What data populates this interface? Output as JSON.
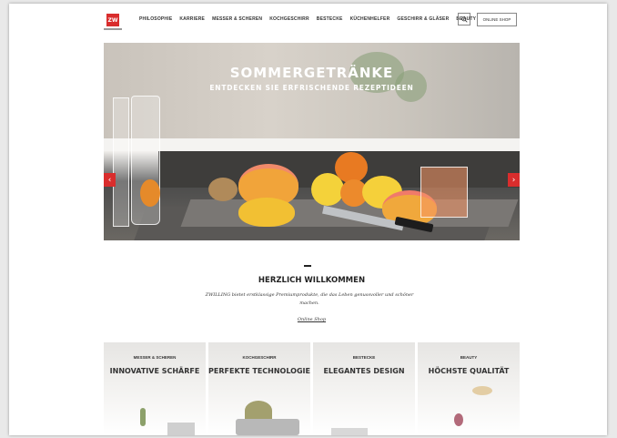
{
  "header": {
    "logo_text": "ZW",
    "nav": [
      "PHILOSOPHIE",
      "KARRIERE",
      "MESSER & SCHEREN",
      "KOCHGESCHIRR",
      "BESTECKE",
      "KÜCHENHELFER",
      "GESCHIRR & GLÄSER",
      "BEAUTY"
    ],
    "shop_button": "ONLINE SHOP",
    "search_icon": "search-icon"
  },
  "hero": {
    "title": "SOMMERGETRÄNKE",
    "subtitle": "ENTDECKEN SIE ERFRISCHENDE REZEPTIDEEN",
    "prev_arrow": "‹",
    "next_arrow": "›"
  },
  "welcome": {
    "title": "HERZLICH WILLKOMMEN",
    "text": "ZWILLING bietet erstklassige Premiumprodukte, die das Leben genussvoller und schöner machen.",
    "link": "Online Shop"
  },
  "cards": [
    {
      "category": "MESSER & SCHEREN",
      "title": "INNOVATIVE SCHÄRFE"
    },
    {
      "category": "KOCHGESCHIRR",
      "title": "PERFEKTE TECHNOLOGIE"
    },
    {
      "category": "BESTECKE",
      "title": "ELEGANTES DESIGN"
    },
    {
      "category": "BEAUTY",
      "title": "HÖCHSTE QUALITÄT"
    }
  ],
  "colors": {
    "brand_red": "#d92d2d",
    "text": "#222222",
    "background": "#ffffff"
  }
}
